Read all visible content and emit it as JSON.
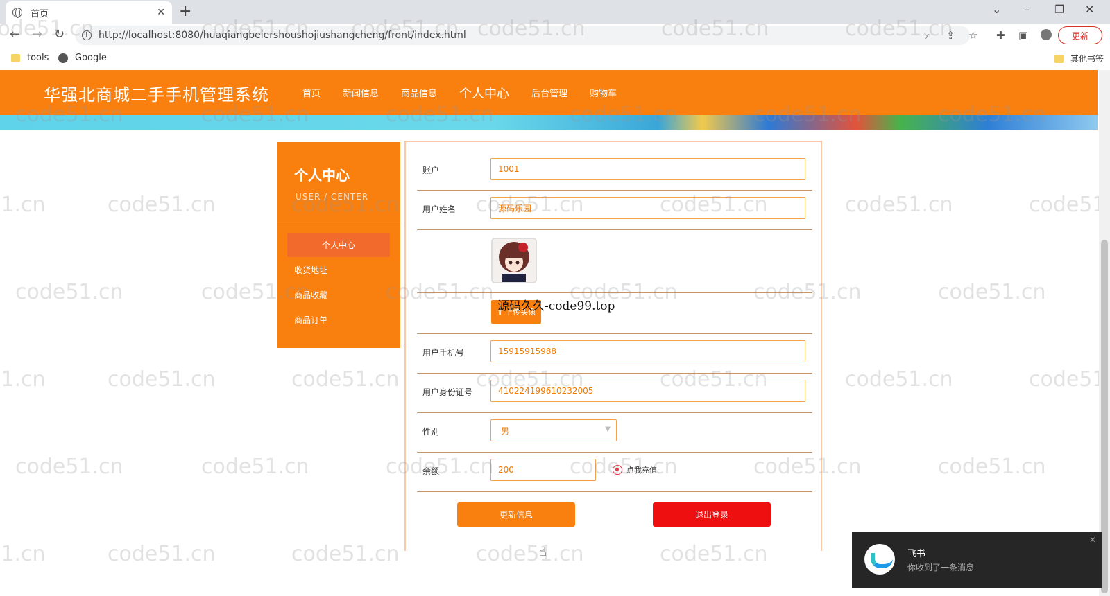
{
  "browser": {
    "tab_title": "首页",
    "tab_close": "✕",
    "new_tab": "+",
    "url": "http://localhost:8080/huaqiangbeiershoushojiushangcheng/front/index.html",
    "update_label": "更新",
    "bookmarks": [
      {
        "label": "tools"
      },
      {
        "label": "Google"
      }
    ],
    "other_bookmarks": "其他书签"
  },
  "site": {
    "title": "华强北商城二手手机管理系统",
    "nav": [
      "首页",
      "新闻信息",
      "商品信息",
      "个人中心",
      "后台管理",
      "购物车"
    ]
  },
  "sidebar": {
    "title": "个人中心",
    "subtitle": "USER / CENTER",
    "active_item": "个人中心",
    "items": [
      "收货地址",
      "商品收藏",
      "商品订单"
    ]
  },
  "form": {
    "account_label": "账户",
    "account_value": "1001",
    "name_label": "用户姓名",
    "name_value": "源码乐园",
    "upload_label": "上传头像",
    "overlay_text": "源码久久-code99.top",
    "phone_label": "用户手机号",
    "phone_value": "15915915988",
    "idcard_label": "用户身份证号",
    "idcard_value": "410224199610232005",
    "gender_label": "性别",
    "gender_value": "男",
    "balance_label": "余额",
    "balance_value": "200",
    "recharge_label": "点我充值",
    "update_button": "更新信息",
    "logout_button": "退出登录"
  },
  "watermark": "code51.cn",
  "notification": {
    "app": "飞书",
    "message": "你收到了一条消息",
    "close": "✕"
  },
  "colors": {
    "primary": "#f97f0f",
    "logout": "#ee1010",
    "panel_border": "#fbc7a6"
  }
}
